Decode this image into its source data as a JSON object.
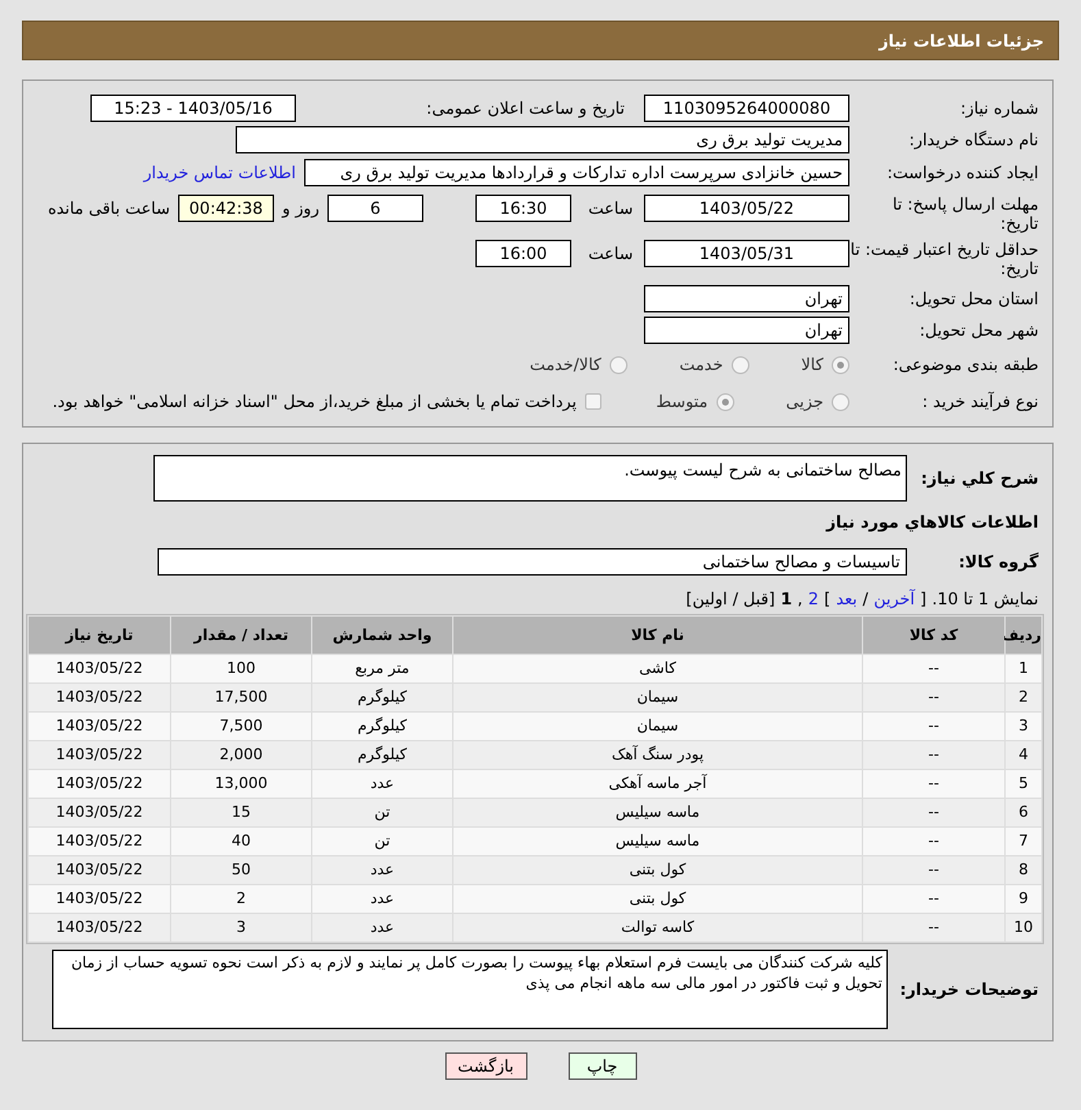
{
  "header": {
    "title": "جزئیات اطلاعات نیاز"
  },
  "need_number": {
    "label": "شماره نیاز:",
    "value": "1103095264000080"
  },
  "announce": {
    "label": "تاریخ و ساعت اعلان عمومی:",
    "value": "1403/05/16 - 15:23"
  },
  "buyer_org": {
    "label": "نام دستگاه خریدار:",
    "value": "مدیریت تولید برق ری"
  },
  "requester": {
    "label": "ایجاد کننده درخواست:",
    "value": "حسین خانزادی سرپرست اداره تدارکات و قراردادها مدیریت تولید برق ری",
    "link": "اطلاعات تماس خریدار"
  },
  "reply_deadline": {
    "label": "مهلت ارسال پاسخ: تا تاریخ:",
    "date": "1403/05/22",
    "time_label": "ساعت",
    "time": "16:30",
    "days": "6",
    "days_label": "روز و",
    "remaining": "00:42:38",
    "remaining_label": "ساعت باقی مانده"
  },
  "price_validity": {
    "label": "حداقل تاریخ اعتبار قیمت: تا تاریخ:",
    "date": "1403/05/31",
    "time_label": "ساعت",
    "time": "16:00"
  },
  "province": {
    "label": "استان محل تحویل:",
    "value": "تهران"
  },
  "city": {
    "label": "شهر محل تحویل:",
    "value": "تهران"
  },
  "category": {
    "label": "طبقه بندی موضوعی:",
    "options": [
      {
        "label": "کالا",
        "selected": true
      },
      {
        "label": "خدمت",
        "selected": false
      },
      {
        "label": "کالا/خدمت",
        "selected": false
      }
    ]
  },
  "process": {
    "label": "نوع فرآیند خرید :",
    "options": [
      {
        "label": "جزیی",
        "selected": false
      },
      {
        "label": "متوسط",
        "selected": true
      }
    ],
    "treasury": {
      "checked": false,
      "label": "پرداخت تمام یا بخشی از مبلغ خرید،از محل \"اسناد خزانه اسلامی\" خواهد بود."
    }
  },
  "summary": {
    "label": "شرح کلي نياز:",
    "value": "مصالح ساختمانی به شرح لیست پیوست."
  },
  "goods_heading": "اطلاعات کالاهاي مورد نياز",
  "goods_group": {
    "label": "گروه کالا:",
    "value": "تاسیسات و مصالح ساختمانی"
  },
  "pagination": [
    {
      "kind": "text",
      "text": "نمایش 1 تا 10."
    },
    {
      "kind": "text",
      "text": "["
    },
    {
      "kind": "link",
      "text": "آخرین"
    },
    {
      "kind": "text",
      "text": "/"
    },
    {
      "kind": "link",
      "text": "بعد"
    },
    {
      "kind": "text",
      "text": "]"
    },
    {
      "kind": "link",
      "text": "2"
    },
    {
      "kind": "text",
      "text": ","
    },
    {
      "kind": "current",
      "text": "1"
    },
    {
      "kind": "text",
      "text": "[قبل / اولین]"
    }
  ],
  "table": {
    "columns": [
      "ردیف",
      "کد کالا",
      "نام کالا",
      "واحد شمارش",
      "تعداد / مقدار",
      "تاریخ نیاز"
    ],
    "rows": [
      [
        "1",
        "--",
        "کاشی",
        "متر مربع",
        "100",
        "1403/05/22"
      ],
      [
        "2",
        "--",
        "سیمان",
        "کیلوگرم",
        "17,500",
        "1403/05/22"
      ],
      [
        "3",
        "--",
        "سیمان",
        "کیلوگرم",
        "7,500",
        "1403/05/22"
      ],
      [
        "4",
        "--",
        "پودر سنگ آهک",
        "کیلوگرم",
        "2,000",
        "1403/05/22"
      ],
      [
        "5",
        "--",
        "آجر ماسه آهکی",
        "عدد",
        "13,000",
        "1403/05/22"
      ],
      [
        "6",
        "--",
        "ماسه سیلیس",
        "تن",
        "15",
        "1403/05/22"
      ],
      [
        "7",
        "--",
        "ماسه سیلیس",
        "تن",
        "40",
        "1403/05/22"
      ],
      [
        "8",
        "--",
        "کول بتنی",
        "عدد",
        "50",
        "1403/05/22"
      ],
      [
        "9",
        "--",
        "کول بتنی",
        "عدد",
        "2",
        "1403/05/22"
      ],
      [
        "10",
        "--",
        "کاسه توالت",
        "عدد",
        "3",
        "1403/05/22"
      ]
    ]
  },
  "buyer_notes": {
    "label": "توضیحات خریدار:",
    "value": "کلیه شرکت کنندگان می بایست فرم استعلام بهاء پیوست را بصورت کامل پر نمایند و لازم به ذکر است نحوه تسویه حساب از زمان تحویل و ثبت فاکتور در امور مالی سه ماهه انجام می پذی"
  },
  "buttons": [
    {
      "kind": "print",
      "label": "چاپ"
    },
    {
      "kind": "back",
      "label": "بازگشت"
    }
  ]
}
